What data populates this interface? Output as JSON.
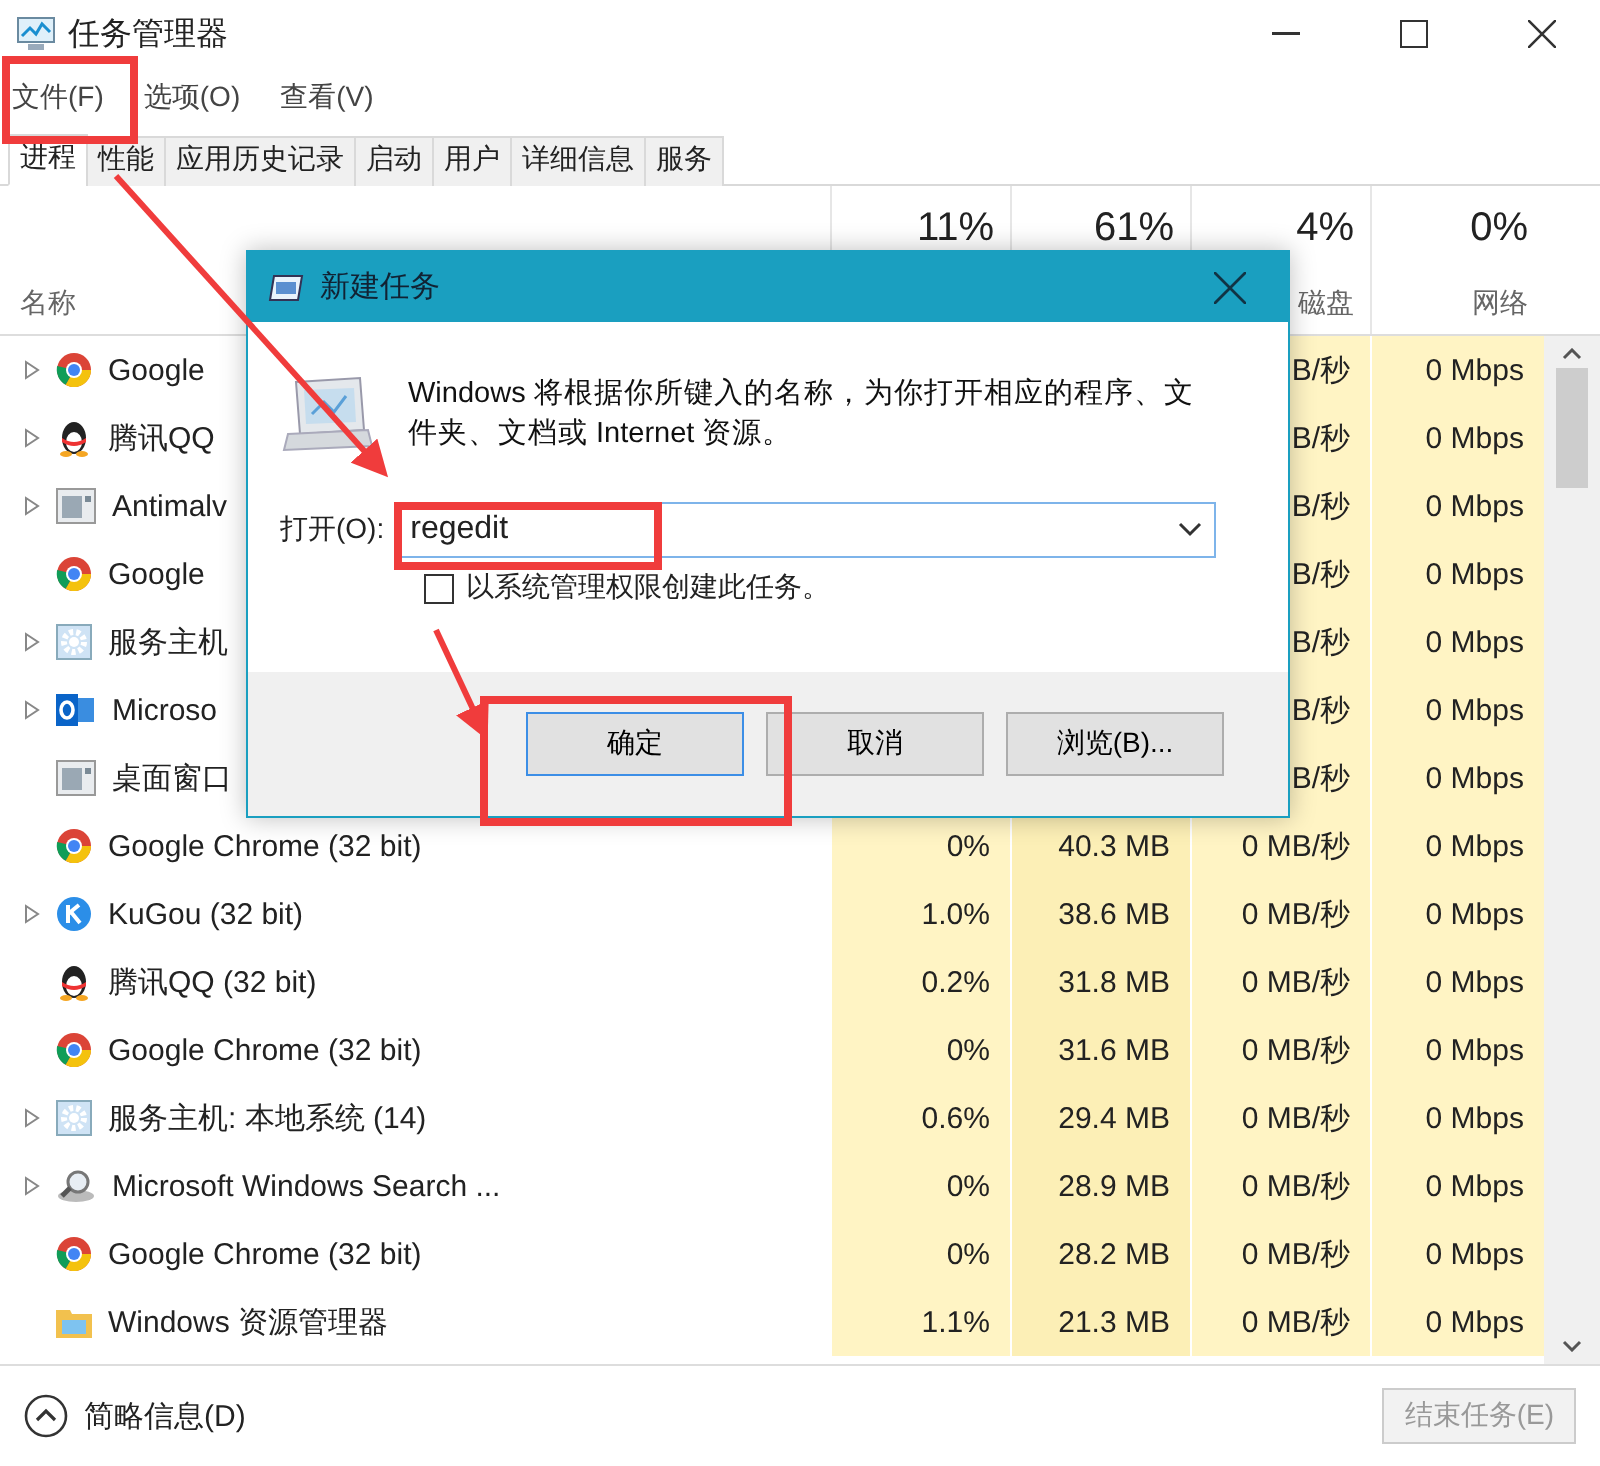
{
  "window": {
    "title": "任务管理器"
  },
  "menu": [
    "文件(F)",
    "选项(O)",
    "查看(V)"
  ],
  "tabs": [
    {
      "label": "进程",
      "selected": true
    },
    {
      "label": "性能",
      "selected": false
    },
    {
      "label": "应用历史记录",
      "selected": false
    },
    {
      "label": "启动",
      "selected": false
    },
    {
      "label": "用户",
      "selected": false
    },
    {
      "label": "详细信息",
      "selected": false
    },
    {
      "label": "服务",
      "selected": false
    }
  ],
  "table": {
    "columns": [
      {
        "label": "名称"
      },
      {
        "percent": "11%"
      },
      {
        "percent": "61%"
      },
      {
        "percent": "4%",
        "label": "磁盘"
      },
      {
        "percent": "0%",
        "label": "网络"
      }
    ],
    "rows": [
      {
        "name": "Google",
        "kind": "chrome",
        "expandable": true,
        "disk": "B/秒",
        "network": "0 Mbps"
      },
      {
        "name": "腾讯QQ",
        "kind": "qq",
        "expandable": true,
        "disk": "B/秒",
        "network": "0 Mbps"
      },
      {
        "name": "Antimalv",
        "kind": "app",
        "expandable": true,
        "disk": "B/秒",
        "network": "0 Mbps"
      },
      {
        "name": "Google",
        "kind": "chrome",
        "expandable": false,
        "disk": "B/秒",
        "network": "0 Mbps"
      },
      {
        "name": "服务主机",
        "kind": "gear",
        "expandable": true,
        "disk": "B/秒",
        "network": "0 Mbps"
      },
      {
        "name": "Microso",
        "kind": "outlook",
        "expandable": true,
        "disk": "B/秒",
        "network": "0 Mbps"
      },
      {
        "name": "桌面窗口",
        "kind": "app",
        "expandable": false,
        "disk": "B/秒",
        "network": "0 Mbps"
      },
      {
        "name": "Google Chrome (32 bit)",
        "kind": "chrome",
        "expandable": false,
        "cpu": "0%",
        "memory": "40.3 MB",
        "disk": "0 MB/秒",
        "network": "0 Mbps"
      },
      {
        "name": "KuGou (32 bit)",
        "kind": "kugou",
        "expandable": true,
        "cpu": "1.0%",
        "memory": "38.6 MB",
        "disk": "0 MB/秒",
        "network": "0 Mbps"
      },
      {
        "name": "腾讯QQ (32 bit)",
        "kind": "qq",
        "expandable": false,
        "cpu": "0.2%",
        "memory": "31.8 MB",
        "disk": "0 MB/秒",
        "network": "0 Mbps"
      },
      {
        "name": "Google Chrome (32 bit)",
        "kind": "chrome",
        "expandable": false,
        "cpu": "0%",
        "memory": "31.6 MB",
        "disk": "0 MB/秒",
        "network": "0 Mbps"
      },
      {
        "name": "服务主机: 本地系统 (14)",
        "kind": "gear",
        "expandable": true,
        "cpu": "0.6%",
        "memory": "29.4 MB",
        "disk": "0 MB/秒",
        "network": "0 Mbps"
      },
      {
        "name": "Microsoft Windows Search ...",
        "kind": "search",
        "expandable": true,
        "cpu": "0%",
        "memory": "28.9 MB",
        "disk": "0 MB/秒",
        "network": "0 Mbps"
      },
      {
        "name": "Google Chrome (32 bit)",
        "kind": "chrome",
        "expandable": false,
        "cpu": "0%",
        "memory": "28.2 MB",
        "disk": "0 MB/秒",
        "network": "0 Mbps"
      },
      {
        "name": "Windows 资源管理器",
        "kind": "folder",
        "expandable": false,
        "cpu": "1.1%",
        "memory": "21.3 MB",
        "disk": "0 MB/秒",
        "network": "0 Mbps"
      }
    ]
  },
  "footer": {
    "details": "简略信息(D)",
    "end_task": {
      "label": "结束任务(E)",
      "disabled": true
    }
  },
  "dialog": {
    "title": "新建任务",
    "message": "Windows 将根据你所键入的名称，为你打开相应的程序、文件夹、文档或 Internet 资源。",
    "open_label": "打开(O):",
    "value": "regedit",
    "admin": {
      "label": "以系统管理权限创建此任务。",
      "checked": false
    },
    "buttons": [
      "确定",
      "取消",
      "浏览(B)..."
    ]
  }
}
